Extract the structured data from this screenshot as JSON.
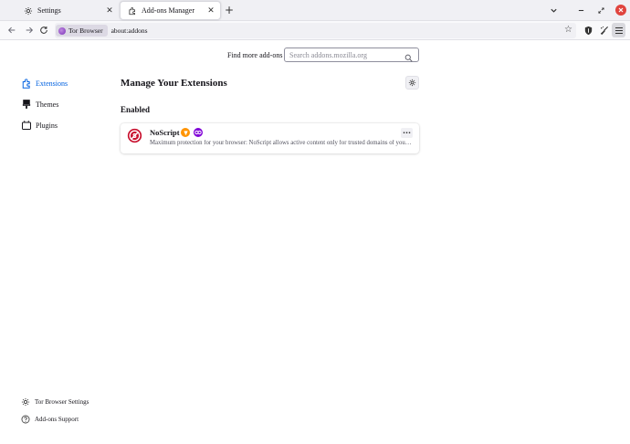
{
  "tabs": [
    {
      "label": "Settings",
      "icon": "gear-icon",
      "active": false
    },
    {
      "label": "Add-ons Manager",
      "icon": "puzzle-icon",
      "active": true
    }
  ],
  "navbar": {
    "identity_label": "Tor Browser",
    "url": "about:addons"
  },
  "search": {
    "find_label": "Find more add-ons",
    "placeholder": "Search addons.mozilla.org"
  },
  "sidebar": {
    "items": [
      {
        "label": "Extensions",
        "icon": "puzzle-icon",
        "selected": true
      },
      {
        "label": "Themes",
        "icon": "brush-icon",
        "selected": false
      },
      {
        "label": "Plugins",
        "icon": "plugin-icon",
        "selected": false
      }
    ],
    "footer": [
      {
        "label": "Tor Browser Settings",
        "icon": "gear-icon"
      },
      {
        "label": "Add-ons Support",
        "icon": "help-icon"
      }
    ]
  },
  "main": {
    "heading": "Manage Your Extensions",
    "section_label": "Enabled",
    "addons": [
      {
        "name": "NoScript",
        "description": "Maximum protection for your browser: NoScript allows active content only for trusted domains of your choice",
        "badges": [
          "recommended-badge-icon",
          "private-browsing-badge-icon"
        ]
      }
    ]
  },
  "colors": {
    "accent": "#0061e0",
    "close_button": "#e0443e",
    "recommended_badge": "#ff9400",
    "private_badge": "#8000d7",
    "noscript_red": "#c8102e"
  }
}
